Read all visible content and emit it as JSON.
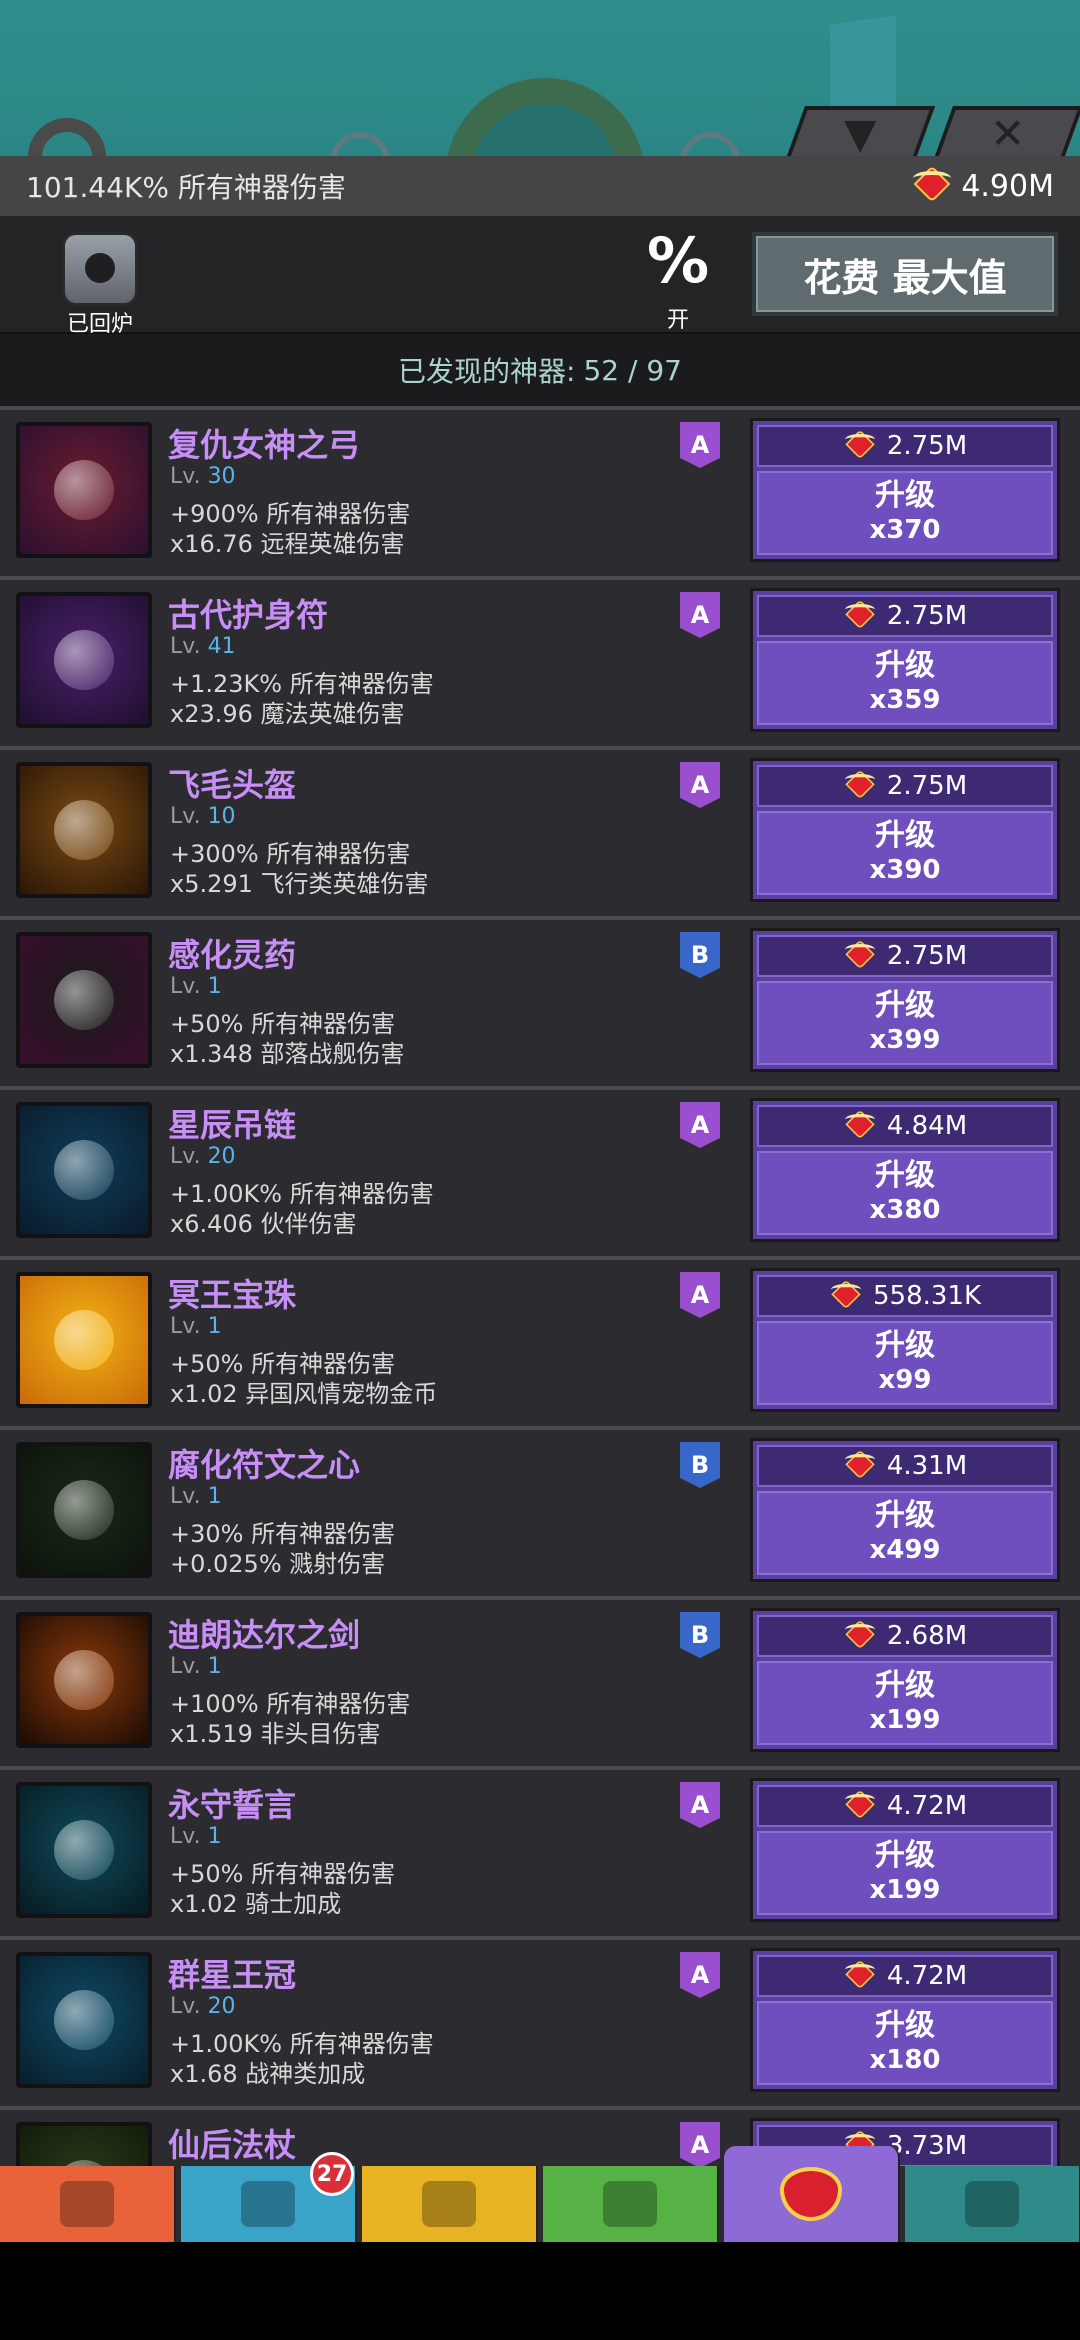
{
  "topbar": {
    "dropdown_icon": "triangle-down-icon",
    "close_icon": "close-icon"
  },
  "infobar": {
    "damage_text": "101.44K% 所有神器伤害",
    "gold_value": "4.90M"
  },
  "controls": {
    "recycle_label": "已回炉",
    "percent_symbol": "%",
    "percent_label": "开",
    "max_button_label": "花费 最大值"
  },
  "found": {
    "label": "已发现的神器:",
    "count": "52 / 97"
  },
  "upgrade_label": "升级",
  "artifacts": [
    {
      "name": "复仇女神之弓",
      "lv_prefix": "Lv.",
      "level": "30",
      "effect1": "+900% 所有神器伤害",
      "effect2": "x16.76 远程英雄伤害",
      "rank": "A",
      "cost": "2.75M",
      "mult": "x370",
      "colors": [
        "#6b1b2e",
        "#2a1030"
      ],
      "icon": "bow-icon"
    },
    {
      "name": "古代护身符",
      "lv_prefix": "Lv.",
      "level": "41",
      "effect1": "+1.23K% 所有神器伤害",
      "effect2": "x23.96 魔法英雄伤害",
      "rank": "A",
      "cost": "2.75M",
      "mult": "x359",
      "colors": [
        "#4a1f6b",
        "#1e0f2e"
      ],
      "icon": "amulet-icon"
    },
    {
      "name": "飞毛头盔",
      "lv_prefix": "Lv.",
      "level": "10",
      "effect1": "+300% 所有神器伤害",
      "effect2": "x5.291 飞行类英雄伤害",
      "rank": "A",
      "cost": "2.75M",
      "mult": "x390",
      "colors": [
        "#7a4a12",
        "#2a1606"
      ],
      "icon": "winged-helmet-icon"
    },
    {
      "name": "感化灵药",
      "lv_prefix": "Lv.",
      "level": "1",
      "effect1": "+50% 所有神器伤害",
      "effect2": "x1.348 部落战舰伤害",
      "rank": "B",
      "cost": "2.75M",
      "mult": "x399",
      "colors": [
        "#1a1a1a",
        "#3a0e2e"
      ],
      "icon": "potion-icon"
    },
    {
      "name": "星辰吊链",
      "lv_prefix": "Lv.",
      "level": "20",
      "effect1": "+1.00K% 所有神器伤害",
      "effect2": "x6.406 伙伴伤害",
      "rank": "A",
      "cost": "4.84M",
      "mult": "x380",
      "colors": [
        "#0f3e5a",
        "#0a1a2a"
      ],
      "icon": "pendant-icon"
    },
    {
      "name": "冥王宝珠",
      "lv_prefix": "Lv.",
      "level": "1",
      "effect1": "+50% 所有神器伤害",
      "effect2": "x1.02 异国风情宠物金币",
      "rank": "A",
      "cost": "558.31K",
      "mult": "x99",
      "colors": [
        "#f3b315",
        "#c86a08"
      ],
      "icon": "orb-icon"
    },
    {
      "name": "腐化符文之心",
      "lv_prefix": "Lv.",
      "level": "1",
      "effect1": "+30% 所有神器伤害",
      "effect2": "+0.025% 溅射伤害",
      "rank": "B",
      "cost": "4.31M",
      "mult": "x499",
      "colors": [
        "#1a2a16",
        "#0c120c"
      ],
      "icon": "rune-heart-icon"
    },
    {
      "name": "迪朗达尔之剑",
      "lv_prefix": "Lv.",
      "level": "1",
      "effect1": "+100% 所有神器伤害",
      "effect2": "x1.519 非头目伤害",
      "rank": "B",
      "cost": "2.68M",
      "mult": "x199",
      "colors": [
        "#8a3a0a",
        "#1a0a04"
      ],
      "icon": "sword-icon"
    },
    {
      "name": "永守誓言",
      "lv_prefix": "Lv.",
      "level": "1",
      "effect1": "+50% 所有神器伤害",
      "effect2": "x1.02 骑士加成",
      "rank": "A",
      "cost": "4.72M",
      "mult": "x199",
      "colors": [
        "#0f4a5a",
        "#071a22"
      ],
      "icon": "knight-helmet-icon"
    },
    {
      "name": "群星王冠",
      "lv_prefix": "Lv.",
      "level": "20",
      "effect1": "+1.00K% 所有神器伤害",
      "effect2": "x1.68 战神类加成",
      "rank": "A",
      "cost": "4.72M",
      "mult": "x180",
      "colors": [
        "#0e4a66",
        "#081e2a"
      ],
      "icon": "crown-icon"
    },
    {
      "name": "仙后法杖",
      "lv_prefix": "Lv.",
      "level": "",
      "effect1": "",
      "effect2": "",
      "rank": "A",
      "cost": "3.73M",
      "mult": "",
      "colors": [
        "#2a3a1a",
        "#101a0a"
      ],
      "icon": "staff-icon"
    }
  ],
  "tabs": [
    {
      "icon": "sword-tab-icon",
      "color": "#e8633a"
    },
    {
      "icon": "hero-tab-icon",
      "color": "#3aa3c8",
      "badge": "27"
    },
    {
      "icon": "equipment-tab-icon",
      "color": "#e8b322"
    },
    {
      "icon": "pet-tab-icon",
      "color": "#57b246"
    },
    {
      "icon": "artifact-tab-icon",
      "color": "#8f6ad6",
      "active": true
    },
    {
      "icon": "shop-tab-icon",
      "color": "#2f8a8a"
    }
  ]
}
